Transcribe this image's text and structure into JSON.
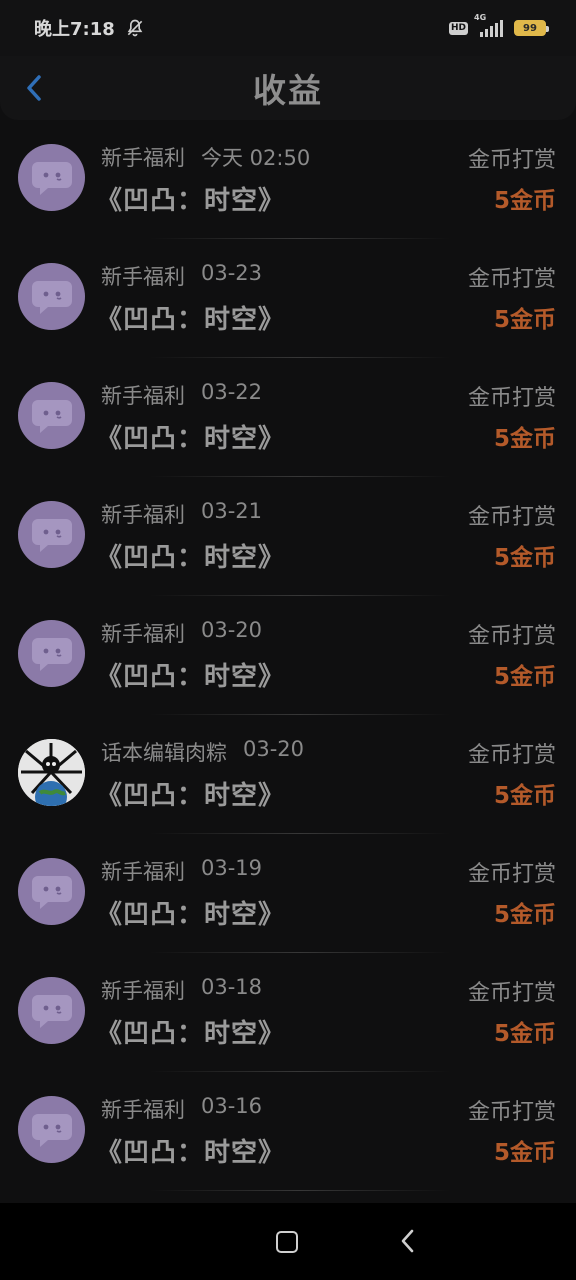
{
  "status_bar": {
    "time": "晚上7:18",
    "hd": "HD",
    "network": "4G",
    "battery": "99"
  },
  "header": {
    "title": "收益"
  },
  "rows": [
    {
      "source": "新手福利",
      "date": "今天 02:50",
      "title": "《凹凸：时空》",
      "type": "金币打赏",
      "amount": "5金币",
      "avatar": "bot"
    },
    {
      "source": "新手福利",
      "date": "03-23",
      "title": "《凹凸：时空》",
      "type": "金币打赏",
      "amount": "5金币",
      "avatar": "bot"
    },
    {
      "source": "新手福利",
      "date": "03-22",
      "title": "《凹凸：时空》",
      "type": "金币打赏",
      "amount": "5金币",
      "avatar": "bot"
    },
    {
      "source": "新手福利",
      "date": "03-21",
      "title": "《凹凸：时空》",
      "type": "金币打赏",
      "amount": "5金币",
      "avatar": "bot"
    },
    {
      "source": "新手福利",
      "date": "03-20",
      "title": "《凹凸：时空》",
      "type": "金币打赏",
      "amount": "5金币",
      "avatar": "bot"
    },
    {
      "source": "话本编辑肉粽",
      "date": "03-20",
      "title": "《凹凸：时空》",
      "type": "金币打赏",
      "amount": "5金币",
      "avatar": "photo"
    },
    {
      "source": "新手福利",
      "date": "03-19",
      "title": "《凹凸：时空》",
      "type": "金币打赏",
      "amount": "5金币",
      "avatar": "bot"
    },
    {
      "source": "新手福利",
      "date": "03-18",
      "title": "《凹凸：时空》",
      "type": "金币打赏",
      "amount": "5金币",
      "avatar": "bot"
    },
    {
      "source": "新手福利",
      "date": "03-16",
      "title": "《凹凸：时空》",
      "type": "金币打赏",
      "amount": "5金币",
      "avatar": "bot"
    }
  ],
  "colors": {
    "background": "#0f0f10",
    "avatar": "#8b7aa8",
    "amount": "#b45a2a",
    "back_icon": "#2f6fb8",
    "battery": "#e0b84a"
  },
  "icons": {
    "back": "chevron-left-icon",
    "bell": "bell-off-icon",
    "signal": "signal-icon",
    "battery": "battery-icon",
    "avatar_bot": "chat-bubble-icon",
    "nav_home": "square-icon",
    "nav_back": "chevron-left-icon"
  }
}
